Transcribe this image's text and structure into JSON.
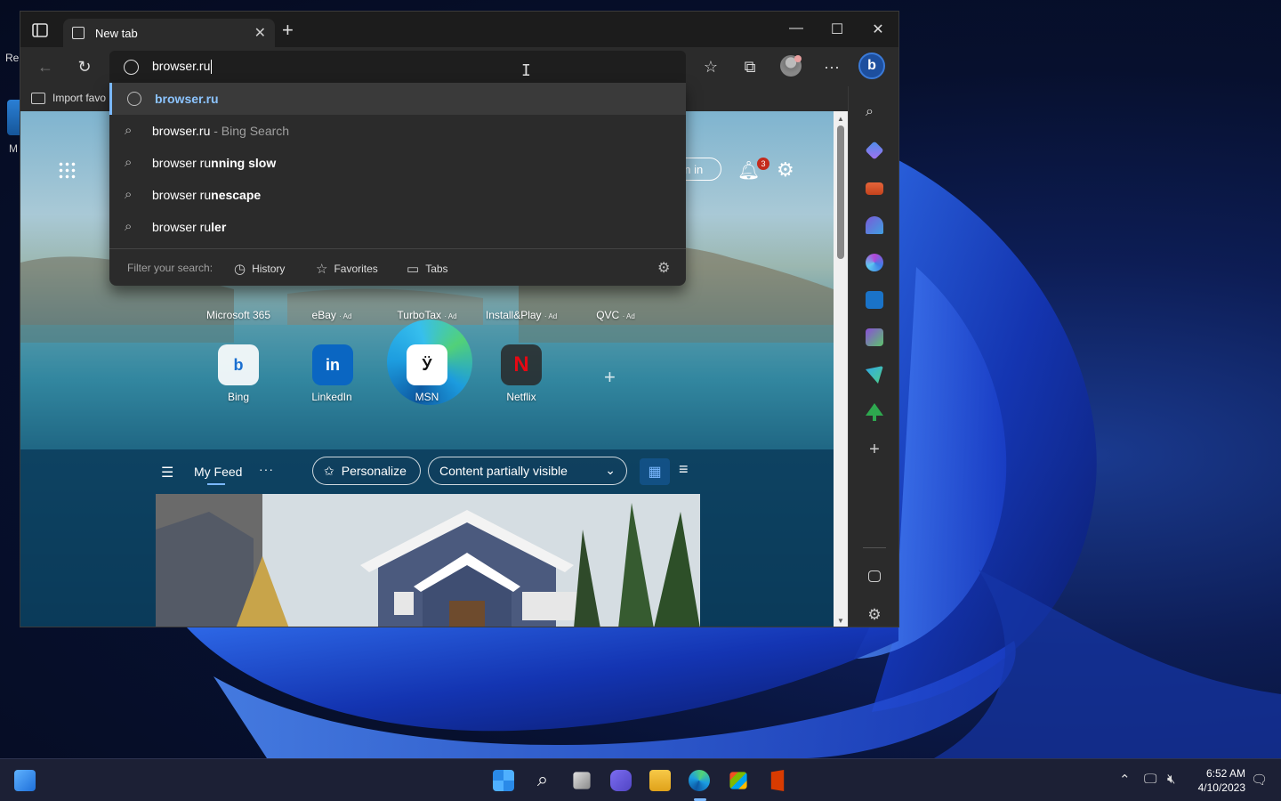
{
  "desktop": {
    "icon_label_partial": "Re",
    "icon2_label_partial": "M"
  },
  "browser": {
    "tab": {
      "title": "New tab"
    },
    "window_controls": {
      "minimize": "—",
      "maximize": "☐",
      "close": "✕"
    },
    "address_bar": {
      "value": "browser.ru"
    },
    "favbar": {
      "import_label": "Import favo"
    },
    "suggestions": [
      {
        "icon": "globe-icon",
        "prefix": "",
        "bold": "browser.ru",
        "suffix": "",
        "sub": "",
        "selected": true
      },
      {
        "icon": "search-icon",
        "prefix": "browser.ru",
        "bold": "",
        "suffix": "",
        "sub": " - Bing Search",
        "selected": false
      },
      {
        "icon": "search-icon",
        "prefix": "browser ru",
        "bold": "nning slow",
        "suffix": "",
        "sub": "",
        "selected": false
      },
      {
        "icon": "search-icon",
        "prefix": "browser ru",
        "bold": "nescape",
        "suffix": "",
        "sub": "",
        "selected": false
      },
      {
        "icon": "search-icon",
        "prefix": "browser ru",
        "bold": "ler",
        "suffix": "",
        "sub": "",
        "selected": false
      }
    ],
    "filter": {
      "label": "Filter your search:",
      "history": "History",
      "favorites": "Favorites",
      "tabs": "Tabs"
    }
  },
  "newtab": {
    "sign_in": "gn in",
    "notification_count": "3",
    "top_row_tiles": [
      {
        "label": "Microsoft 365",
        "ad": ""
      },
      {
        "label": "eBay",
        "ad": "· Ad"
      },
      {
        "label": "TurboTax",
        "ad": "· Ad"
      },
      {
        "label": "Install&Play",
        "ad": "· Ad"
      },
      {
        "label": "QVC",
        "ad": "· Ad"
      }
    ],
    "tiles": [
      {
        "label": "Bing",
        "glyph": "b"
      },
      {
        "label": "LinkedIn",
        "glyph": "in"
      },
      {
        "label": "MSN",
        "glyph": "Ӱ"
      },
      {
        "label": "Netflix",
        "glyph": "N"
      }
    ],
    "feed": {
      "title": "My Feed",
      "more": "···",
      "personalize": "Personalize",
      "visibility": "Content partially visible"
    }
  },
  "taskbar": {
    "time": "6:52 AM",
    "date": "4/10/2023"
  },
  "colors": {
    "accent": "#7ab8ff",
    "badge_red": "#c42b1c",
    "browser_bg": "#2b2b2b"
  }
}
